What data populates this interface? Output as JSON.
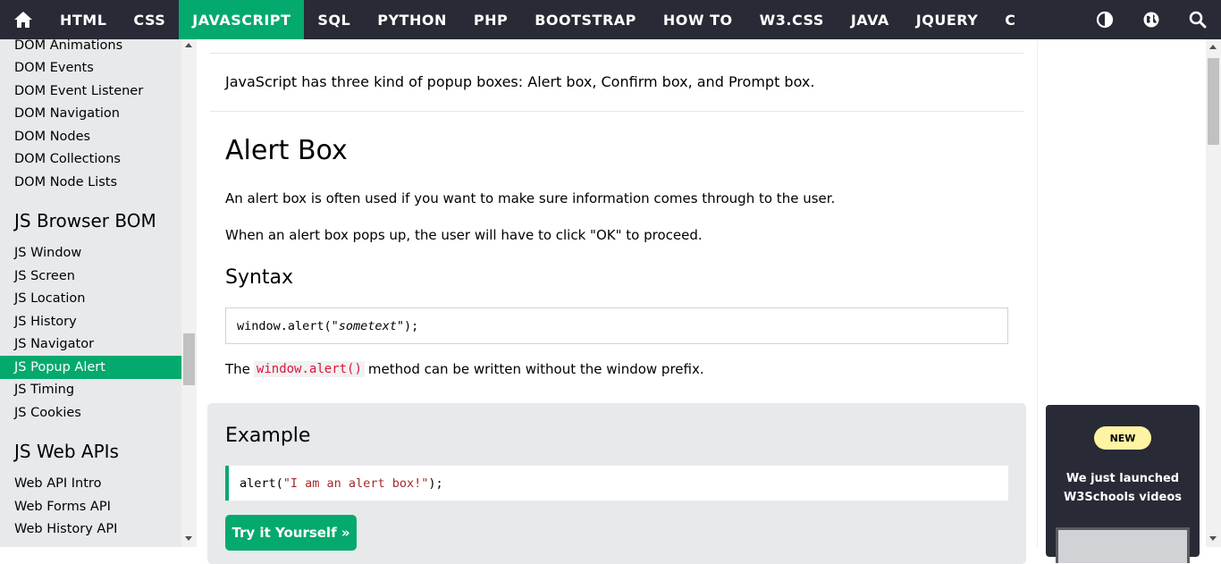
{
  "topnav": {
    "items": [
      {
        "label": "HTML",
        "active": false
      },
      {
        "label": "CSS",
        "active": false
      },
      {
        "label": "JAVASCRIPT",
        "active": true
      },
      {
        "label": "SQL",
        "active": false
      },
      {
        "label": "PYTHON",
        "active": false
      },
      {
        "label": "PHP",
        "active": false
      },
      {
        "label": "BOOTSTRAP",
        "active": false
      },
      {
        "label": "HOW TO",
        "active": false
      },
      {
        "label": "W3.CSS",
        "active": false
      },
      {
        "label": "JAVA",
        "active": false
      },
      {
        "label": "JQUERY",
        "active": false
      },
      {
        "label": "C",
        "active": false
      }
    ],
    "icons": [
      "home-icon",
      "contrast-icon",
      "globe-icon",
      "search-icon"
    ]
  },
  "sidebar": {
    "dom_links": [
      "DOM Animations",
      "DOM Events",
      "DOM Event Listener",
      "DOM Navigation",
      "DOM Nodes",
      "DOM Collections",
      "DOM Node Lists"
    ],
    "bom_heading": "JS Browser BOM",
    "bom_links": [
      "JS Window",
      "JS Screen",
      "JS Location",
      "JS History",
      "JS Navigator",
      "JS Popup Alert",
      "JS Timing",
      "JS Cookies"
    ],
    "active_link": "JS Popup Alert",
    "webapi_heading": "JS Web APIs",
    "webapi_links": [
      "Web API Intro",
      "Web Forms API",
      "Web History API"
    ]
  },
  "main": {
    "intro": "JavaScript has three kind of popup boxes: Alert box, Confirm box, and Prompt box.",
    "heading": "Alert Box",
    "p1": "An alert box is often used if you want to make sure information comes through to the user.",
    "p2": "When an alert box pops up, the user will have to click \"OK\" to proceed.",
    "syntax_heading": "Syntax",
    "syntax_code_prefix": "window.alert(\"",
    "syntax_code_italic": "sometext",
    "syntax_code_suffix": "\");",
    "p3_before": "The",
    "p3_code": "window.alert()",
    "p3_after": "method can be written without the window prefix.",
    "example": {
      "title": "Example",
      "code_prefix": "alert(",
      "code_string": "\"I am an alert box!\"",
      "code_suffix": ");",
      "button": "Try it Yourself »"
    }
  },
  "ad": {
    "badge": "NEW",
    "line1": "We just launched",
    "line2": "W3Schools videos"
  },
  "colors": {
    "nav_bg": "#282A35",
    "accent": "#04AA6D",
    "sidebar_bg": "#E7E9EB",
    "badge_bg": "#FFF4A3",
    "inline_code": "#DC143C"
  }
}
